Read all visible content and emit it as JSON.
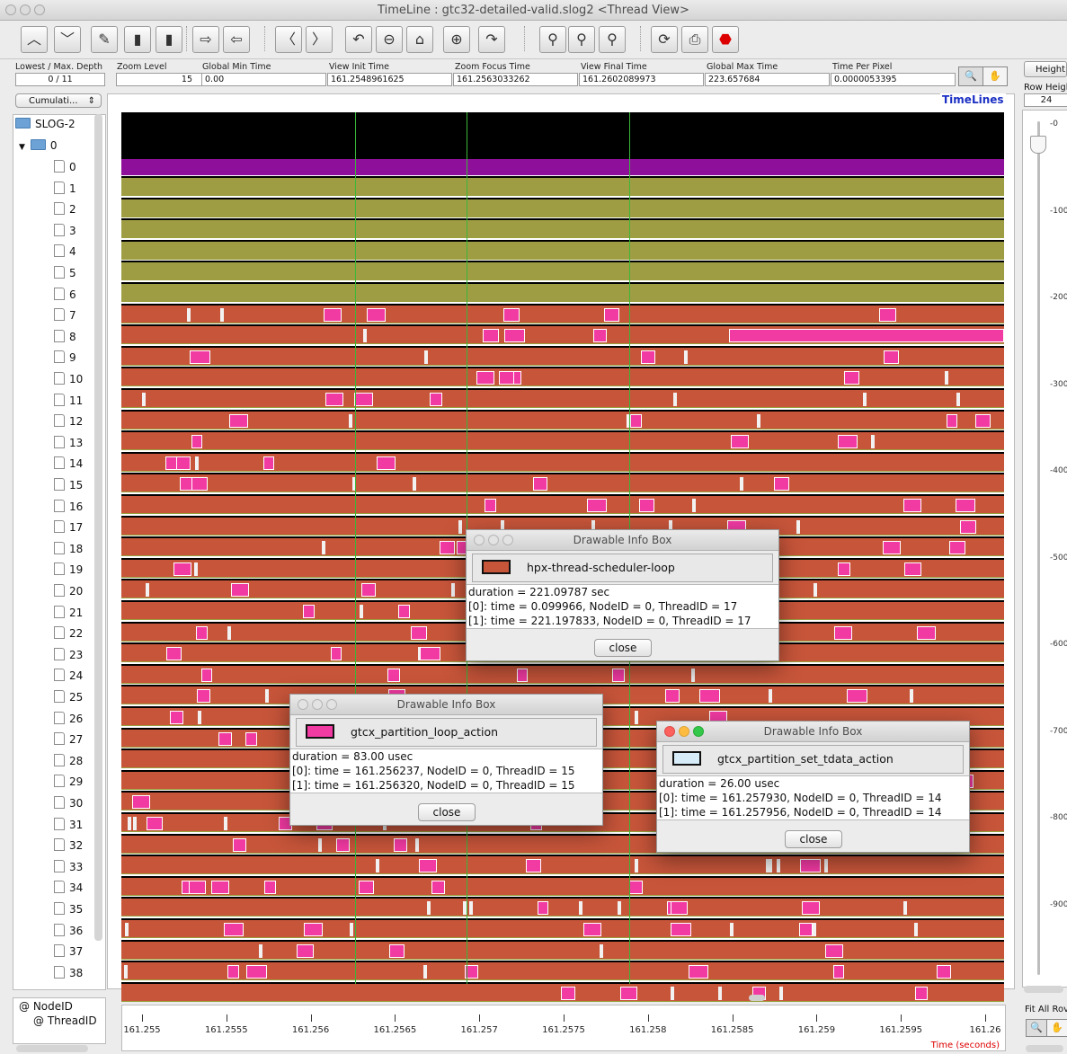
{
  "window": {
    "title": "TimeLine : gtc32-detailed-valid.slog2  <Thread View>"
  },
  "toolbar": {
    "icons": [
      "up-icon",
      "down-icon",
      "edit-icon",
      "delete-icon",
      "trash-icon",
      "export-icon",
      "import-icon",
      "scroll-left-icon",
      "scroll-right-icon",
      "undo-zoom-icon",
      "zoom-out-icon",
      "home-icon",
      "zoom-in-icon",
      "redo-zoom-icon",
      "search-backward-icon",
      "search-icon",
      "search-forward-icon",
      "refresh-icon",
      "print-icon",
      "stop-icon"
    ]
  },
  "fields": {
    "depth": {
      "label": "Lowest / Max. Depth",
      "value": "0 / 11"
    },
    "zoom_level": {
      "label": "Zoom Level",
      "value": "15"
    },
    "global_min": {
      "label": "Global Min Time",
      "value": "0.00"
    },
    "view_init": {
      "label": "View  Init Time",
      "value": "161.2548961625"
    },
    "zoom_focus": {
      "label": "Zoom Focus Time",
      "value": "161.2563033262"
    },
    "view_final": {
      "label": "View Final Time",
      "value": "161.2602089973"
    },
    "global_max": {
      "label": "Global Max Time",
      "value": "223.657684"
    },
    "time_per_pixel": {
      "label": "Time Per Pixel",
      "value": "0.0000053395"
    }
  },
  "left": {
    "mode_select": "Cumulati...",
    "tree_root": "SLOG-2",
    "tree_node": "0",
    "threads": [
      "0",
      "1",
      "2",
      "3",
      "4",
      "5",
      "6",
      "7",
      "8",
      "9",
      "10",
      "11",
      "12",
      "13",
      "14",
      "15",
      "16",
      "17",
      "18",
      "19",
      "20",
      "21",
      "22",
      "23",
      "24",
      "25",
      "26",
      "27",
      "28",
      "29",
      "30",
      "31",
      "32",
      "33",
      "34",
      "35",
      "36",
      "37",
      "38"
    ],
    "legend_node": "@ NodeID",
    "legend_thread": "@ ThreadID"
  },
  "canvas": {
    "timelines_label": "TimeLines"
  },
  "right": {
    "height_button": "Height",
    "row_height_label": "Row Heigh",
    "row_height_value": "24",
    "ticks": [
      "-0",
      "-100",
      "-200",
      "-300",
      "-400",
      "-500",
      "-600",
      "-700",
      "-800",
      "-900"
    ],
    "fit_all": "Fit All Rov"
  },
  "time_axis": {
    "ticks": [
      "161.255",
      "161.2555",
      "161.256",
      "161.2565",
      "161.257",
      "161.2575",
      "161.258",
      "161.2585",
      "161.259",
      "161.2595",
      "161.26"
    ],
    "label": "Time (seconds)"
  },
  "colors": {
    "state_bg": "#c7553a",
    "state_olive": "#9f9d44",
    "state_purple": "#8e0f9a",
    "event_pink": "#f23aa3",
    "focus_line": "#39b739"
  },
  "dialogs": [
    {
      "title": "Drawable Info Box",
      "name": "hpx-thread-scheduler-loop",
      "color": "#c7553a",
      "lines": [
        "duration = 221.09787 sec",
        "[0]: time = 0.099966, NodeID = 0, ThreadID = 17",
        "[1]: time = 221.197833, NodeID = 0, ThreadID = 17"
      ],
      "close": "close"
    },
    {
      "title": "Drawable Info Box",
      "name": "gtcx_partition_loop_action",
      "color": "#f23aa3",
      "lines": [
        "duration = 83.00 usec",
        "[0]: time = 161.256237, NodeID = 0, ThreadID = 15",
        "[1]: time = 161.256320, NodeID = 0, ThreadID = 15"
      ],
      "close": "close"
    },
    {
      "title": "Drawable Info Box",
      "name": "gtcx_partition_set_tdata_action",
      "color": "#d6ecf8",
      "lines": [
        "duration = 26.00 usec",
        "[0]: time = 161.257930, NodeID = 0, ThreadID = 14",
        "[1]: time = 161.257956, NodeID = 0, ThreadID = 14"
      ],
      "close": "close"
    }
  ]
}
